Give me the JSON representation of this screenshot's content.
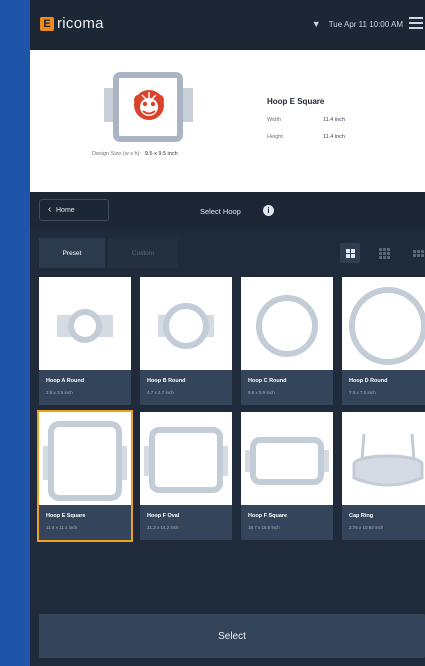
{
  "app": {
    "logo_letter": "E",
    "logo_text": "ricoma"
  },
  "status": {
    "datetime": "Tue Apr 11  10:00 AM"
  },
  "preview": {
    "design_size_label": "Design Size (w x h):",
    "design_size_value": "9.5 x 9.5 inch",
    "hoop_title": "Hoop E Square",
    "width_label": "Width",
    "width_value": "11.4 inch",
    "height_label": "Height",
    "height_value": "11.4 inch"
  },
  "header": {
    "home_label": "Home",
    "title": "Select Hoop",
    "info_glyph": "i"
  },
  "tabs": {
    "preset": "Preset",
    "custom": "Custom"
  },
  "hoops": [
    {
      "name": "Hoop A Round",
      "size": "3.5 x 3.5 inch",
      "shape": "round-s",
      "selected": false
    },
    {
      "name": "Hoop B Round",
      "size": "4.7 x 4.7 inch",
      "shape": "round-m",
      "selected": false
    },
    {
      "name": "Hoop C Round",
      "size": "5.9 x 5.9 inch",
      "shape": "round-l",
      "selected": false
    },
    {
      "name": "Hoop D Round",
      "size": "7.5 x 7.5 inch",
      "shape": "round-xl",
      "selected": false
    },
    {
      "name": "Hoop E Square",
      "size": "11.4 x 11.4 inch",
      "shape": "square",
      "selected": true
    },
    {
      "name": "Hoop F Oval",
      "size": "21.3 x 14.2 inch",
      "shape": "oval",
      "selected": false
    },
    {
      "name": "Hoop F Square",
      "size": "15.7 x 15.5 inch",
      "shape": "square-wide",
      "selected": false
    },
    {
      "name": "Cap Ring",
      "size": "2.76 x 10.93 inch",
      "shape": "cap",
      "selected": false
    }
  ],
  "actions": {
    "select_label": "Select"
  },
  "colors": {
    "accent": "#f0a21e",
    "brand": "#f08a1e",
    "design": "#d9432c"
  }
}
